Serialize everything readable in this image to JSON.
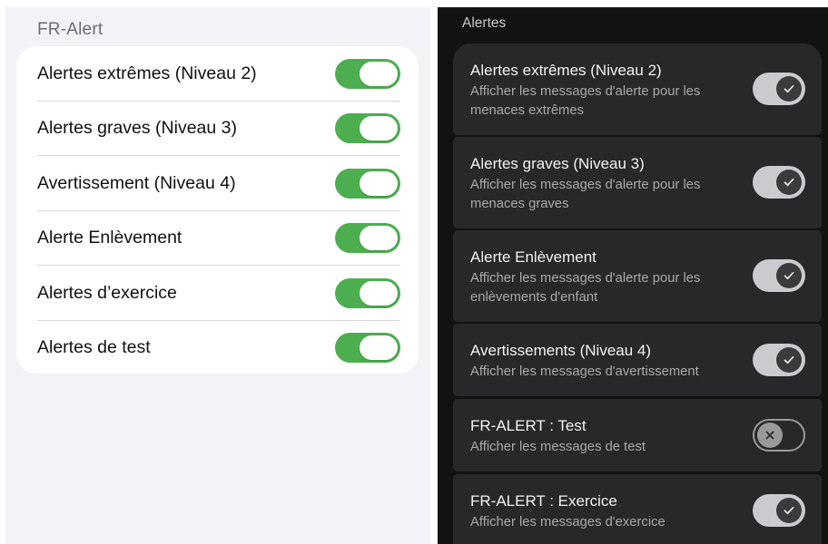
{
  "ios": {
    "header": "FR-Alert",
    "toggle_color": "#4cae4f",
    "items": [
      {
        "label": "Alertes extrêmes (Niveau 2)",
        "enabled": true
      },
      {
        "label": "Alertes graves (Niveau 3)",
        "enabled": true
      },
      {
        "label": "Avertissement (Niveau 4)",
        "enabled": true
      },
      {
        "label": "Alerte Enlèvement",
        "enabled": true
      },
      {
        "label": "Alertes d’exercice",
        "enabled": true
      },
      {
        "label": "Alertes de test",
        "enabled": true
      }
    ]
  },
  "android": {
    "header": "Alertes",
    "items": [
      {
        "title": "Alertes extrêmes (Niveau 2)",
        "subtitle": "Afficher les messages d'alerte pour les menaces extrêmes",
        "enabled": true,
        "icon": "check-icon"
      },
      {
        "title": "Alertes graves (Niveau 3)",
        "subtitle": "Afficher les messages d'alerte pour les menaces graves",
        "enabled": true,
        "icon": "check-icon"
      },
      {
        "title": "Alerte Enlèvement",
        "subtitle": "Afficher les messages d'alerte pour les enlèvements d'enfant",
        "enabled": true,
        "icon": "check-icon"
      },
      {
        "title": "Avertissements (Niveau 4)",
        "subtitle": "Afficher les messages d'avertissement",
        "enabled": true,
        "icon": "check-icon"
      },
      {
        "title": "FR-ALERT : Test",
        "subtitle": "Afficher les messages de test",
        "enabled": false,
        "icon": "close-icon"
      },
      {
        "title": "FR-ALERT : Exercice",
        "subtitle": "Afficher les messages d'exercice",
        "enabled": true,
        "icon": "check-icon"
      }
    ]
  }
}
